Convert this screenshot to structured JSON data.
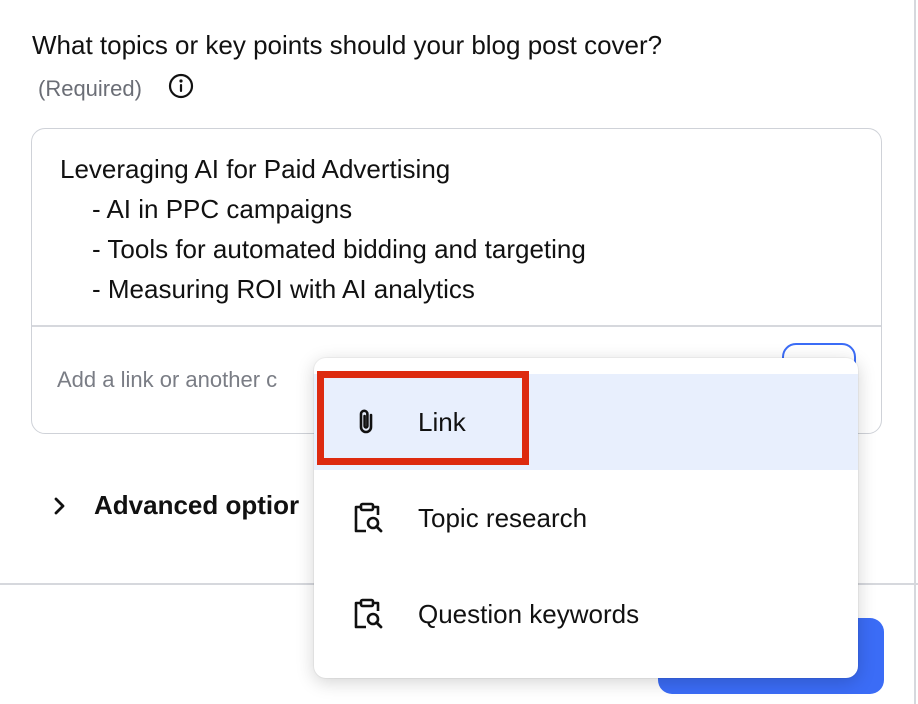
{
  "form": {
    "question": "What topics or key points should your blog post cover?",
    "required_label": "(Required)",
    "topics_text": {
      "heading": "Leveraging AI for Paid Advertising",
      "bullets": [
        "- AI in PPC campaigns",
        "- Tools for automated bidding and targeting",
        "- Measuring ROI with AI analytics"
      ]
    },
    "link_input_placeholder": "Add a link or another c",
    "advanced_options_label": "Advanced optior"
  },
  "dropdown": {
    "items": [
      {
        "label": "Link",
        "icon": "paperclip-icon",
        "state": "hovered"
      },
      {
        "label": "Topic research",
        "icon": "clipboard-search-icon"
      },
      {
        "label": "Question keywords",
        "icon": "clipboard-search-icon"
      }
    ]
  },
  "colors": {
    "accent": "#3b6cf6",
    "highlight": "#dd2a0f",
    "hover_bg": "#e8effd"
  }
}
